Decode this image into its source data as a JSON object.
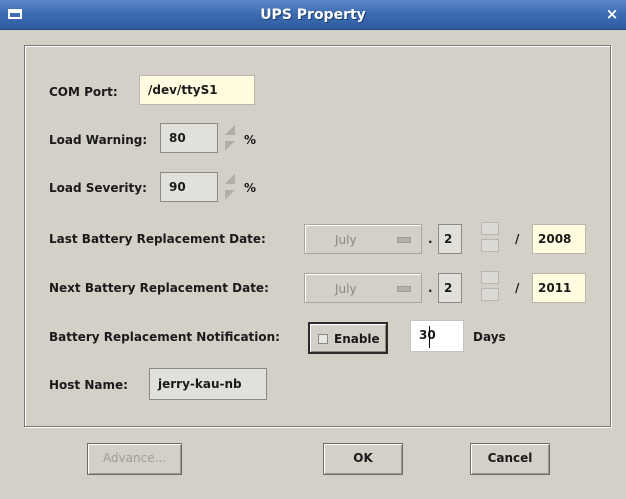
{
  "window": {
    "title": "UPS Property",
    "close_glyph": "×",
    "icon": "window-menu-icon"
  },
  "form": {
    "com_port": {
      "label": "COM Port:",
      "value": "/dev/ttyS1"
    },
    "load_warning": {
      "label": "Load Warning:",
      "value": "80",
      "unit": "%"
    },
    "load_severity": {
      "label": "Load Severity:",
      "value": "90",
      "unit": "%"
    },
    "last_replacement": {
      "label": "Last Battery Replacement Date:",
      "month": "July",
      "dot": ".",
      "day": "2",
      "slash": "/",
      "year": "2008"
    },
    "next_replacement": {
      "label": "Next Battery Replacement Date:",
      "month": "July",
      "dot": ".",
      "day": "2",
      "slash": "/",
      "year": "2011"
    },
    "notification": {
      "label": "Battery Replacement Notification:",
      "enable_label": "Enable",
      "enabled": false,
      "days_value": "30",
      "days_unit": "Days"
    },
    "host_name": {
      "label": "Host Name:",
      "value": "jerry-kau-nb"
    }
  },
  "buttons": {
    "advance": "Advance...",
    "ok": "OK",
    "cancel": "Cancel"
  },
  "colors": {
    "titlebar": "#3f6db3",
    "dialog_bg": "#d4d0c8",
    "input_highlight": "#fffce0"
  }
}
